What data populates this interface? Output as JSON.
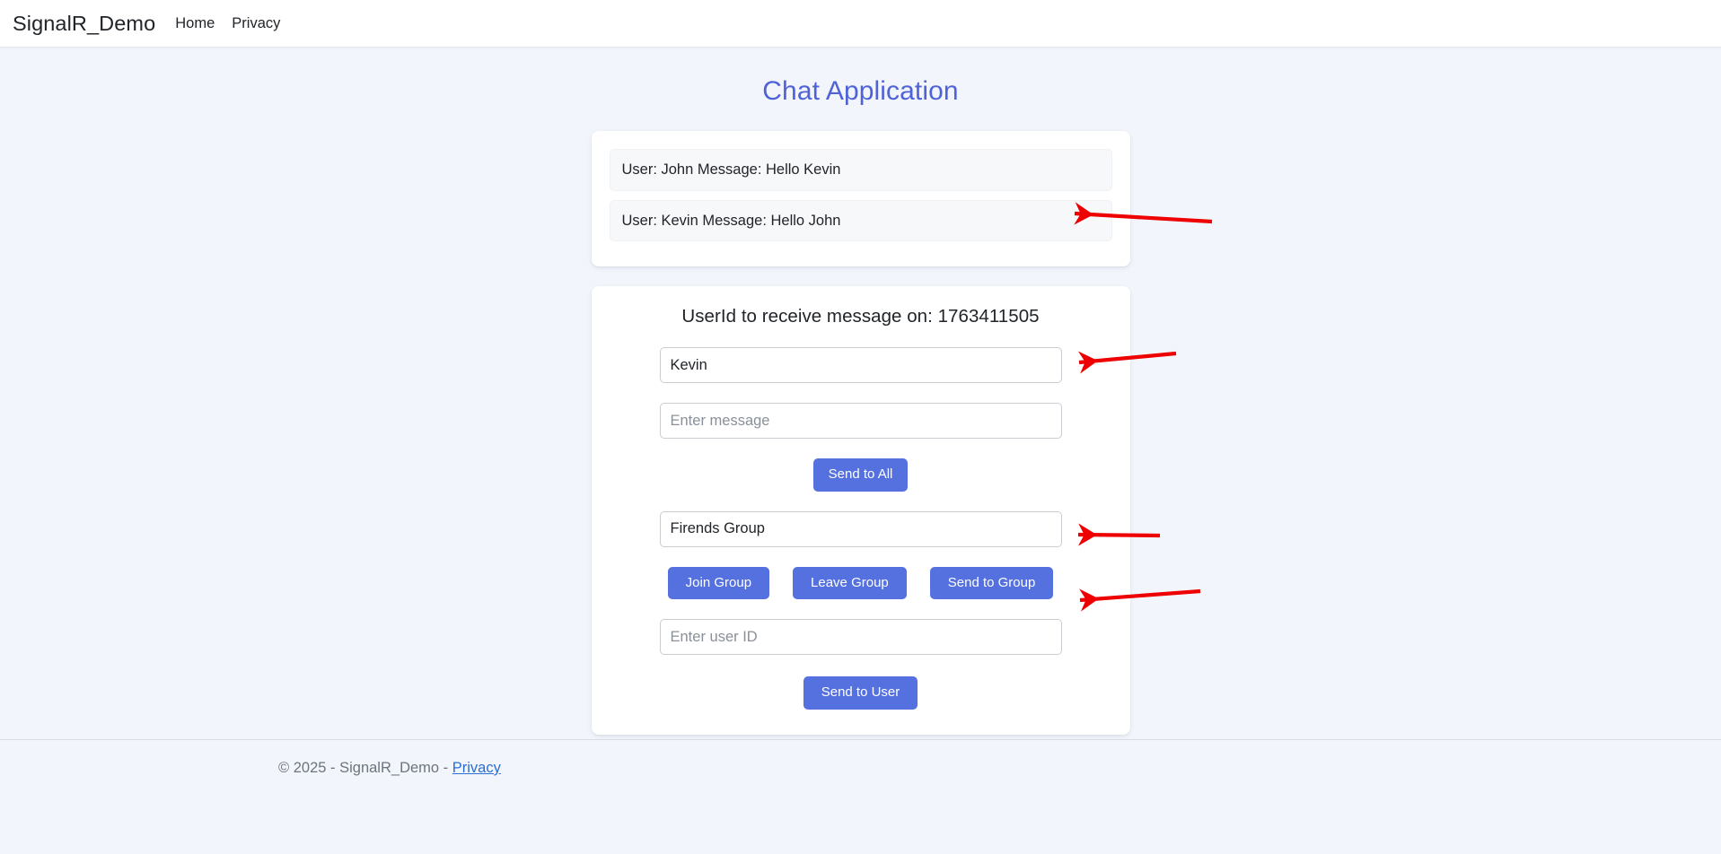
{
  "navbar": {
    "brand": "SignalR_Demo",
    "links": [
      {
        "label": "Home"
      },
      {
        "label": "Privacy"
      }
    ]
  },
  "main": {
    "title": "Chat Application",
    "messages": [
      {
        "text": "User: John Message: Hello Kevin"
      },
      {
        "text": "User: Kevin Message: Hello John"
      }
    ],
    "controls": {
      "heading": "UserId to receive message on: 1763411505",
      "user_id_value": "1763411505",
      "user_name_input": {
        "value": "Kevin",
        "placeholder": "Enter user name"
      },
      "message_input": {
        "value": "",
        "placeholder": "Enter message"
      },
      "send_all_button": "Send to All",
      "group_input": {
        "value": "Firends Group",
        "placeholder": "Enter group name"
      },
      "join_group_button": "Join Group",
      "leave_group_button": "Leave Group",
      "send_group_button": "Send to Group",
      "user_id_input": {
        "value": "",
        "placeholder": "Enter user ID"
      },
      "send_user_button": "Send to User"
    }
  },
  "footer": {
    "copyright": "© 2025 - SignalR_Demo - ",
    "privacy_link": "Privacy"
  },
  "annotations": {
    "color": "#ee0000",
    "arrows": [
      {
        "name": "arrow-to-message-list"
      },
      {
        "name": "arrow-to-user-name-input"
      },
      {
        "name": "arrow-to-group-input"
      },
      {
        "name": "arrow-to-group-buttons"
      }
    ]
  },
  "colors": {
    "page_background": "#f2f5fb",
    "card_background": "#ffffff",
    "title": "#4f63d6",
    "button": "#5570df",
    "message_item": "#f7f8fa",
    "footer_text": "#6c757d",
    "footer_link": "#2b6ed1",
    "annotation_red": "#ee0000"
  }
}
